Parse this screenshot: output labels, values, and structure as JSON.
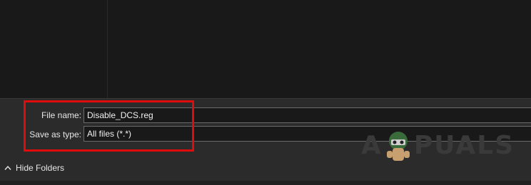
{
  "dialog": {
    "file_name_label": "File name:",
    "file_name_value": "Disable_DCS.reg",
    "save_type_label": "Save as type:",
    "save_type_value": "All files  (*.*)",
    "hide_folders_label": "Hide Folders"
  },
  "annotation": {
    "highlight_color": "#e00b0b"
  },
  "watermark": {
    "text_left": "A",
    "text_right": "PUALS",
    "icon": "mascot-icon"
  },
  "colors": {
    "background": "#1b1b1b",
    "panel": "#2b2b2b",
    "input_bg": "#191919",
    "text": "#e6e6e6"
  }
}
